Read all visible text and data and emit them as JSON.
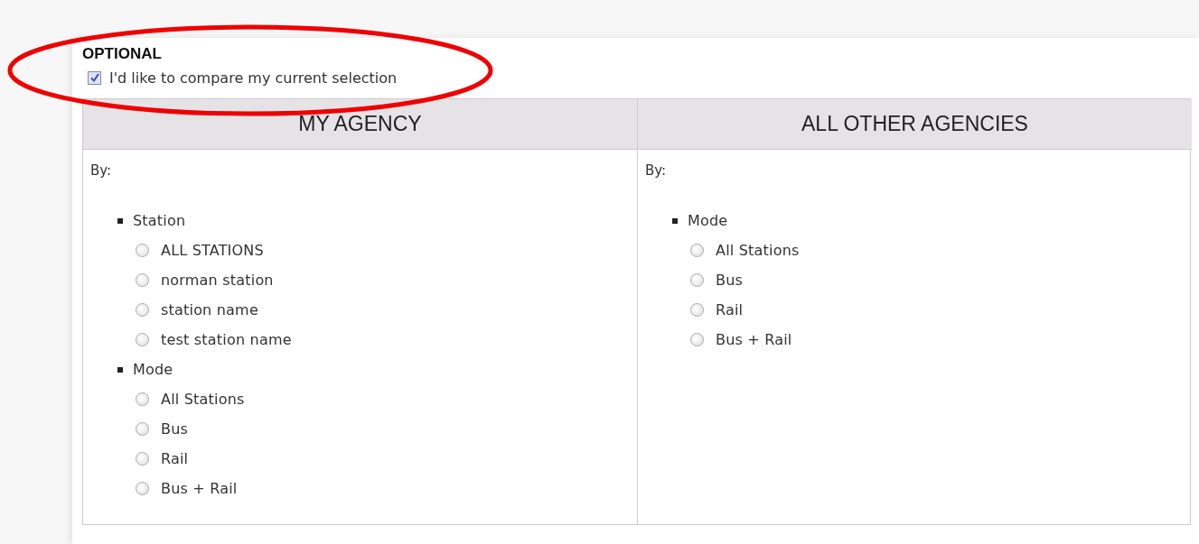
{
  "section": {
    "title": "OPTIONAL",
    "compare": {
      "label": "I'd like to compare my current selection",
      "checked": true
    }
  },
  "columns": [
    {
      "heading": "MY AGENCY",
      "by_label": "By:",
      "groups": [
        {
          "label": "Station",
          "options": [
            {
              "label": "ALL STATIONS",
              "selected": false
            },
            {
              "label": "norman station",
              "selected": false
            },
            {
              "label": "station name",
              "selected": false
            },
            {
              "label": "test station name",
              "selected": false
            }
          ]
        },
        {
          "label": "Mode",
          "options": [
            {
              "label": "All Stations",
              "selected": false
            },
            {
              "label": "Bus",
              "selected": false
            },
            {
              "label": "Rail",
              "selected": false
            },
            {
              "label": "Bus + Rail",
              "selected": false
            }
          ]
        }
      ]
    },
    {
      "heading": "ALL OTHER AGENCIES",
      "by_label": "By:",
      "groups": [
        {
          "label": "Mode",
          "options": [
            {
              "label": "All Stations",
              "selected": false
            },
            {
              "label": "Bus",
              "selected": false
            },
            {
              "label": "Rail",
              "selected": false
            },
            {
              "label": "Bus + Rail",
              "selected": false
            }
          ]
        }
      ]
    }
  ]
}
